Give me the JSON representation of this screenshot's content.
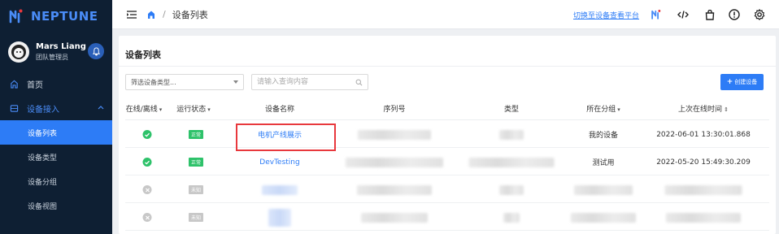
{
  "brand": {
    "name": "NEPTUNE"
  },
  "user": {
    "name": "Mars Liang",
    "role": "团队管理员"
  },
  "nav": {
    "home": "首页",
    "device_access": "设备接入",
    "sub": [
      "设备列表",
      "设备类型",
      "设备分组",
      "设备视图"
    ]
  },
  "topbar": {
    "breadcrumb_current": "设备列表",
    "breadcrumb_sep": "/",
    "switch_link": "切换至设备查看平台"
  },
  "card": {
    "title": "设备列表",
    "filter_select": "筛选设备类型...",
    "search_placeholder": "请输入查询内容",
    "create_button": "创建设备",
    "create_plus": "+"
  },
  "table": {
    "headers": {
      "online": "在线/离线",
      "run_status": "运行状态",
      "name": "设备名称",
      "serial": "序列号",
      "type": "类型",
      "group": "所在分组",
      "last_online": "上次在线时间"
    },
    "rows": [
      {
        "status_badge": "正常",
        "name": "电机产线展示",
        "group": "我的设备",
        "last_online": "2022-06-01 13:30:01.868"
      },
      {
        "status_badge": "正常",
        "name": "DevTesting",
        "group": "测试用",
        "last_online": "2022-05-20 15:49:30.209"
      },
      {
        "status_badge": "未知",
        "name": "",
        "group": "",
        "last_online": ""
      },
      {
        "status_badge": "未知",
        "name": "",
        "group": "",
        "last_online": ""
      }
    ]
  },
  "colors": {
    "accent": "#2d7cf6",
    "sidebar_bg": "#0e1f33",
    "success": "#2ec26a",
    "highlight": "#e8383d"
  }
}
